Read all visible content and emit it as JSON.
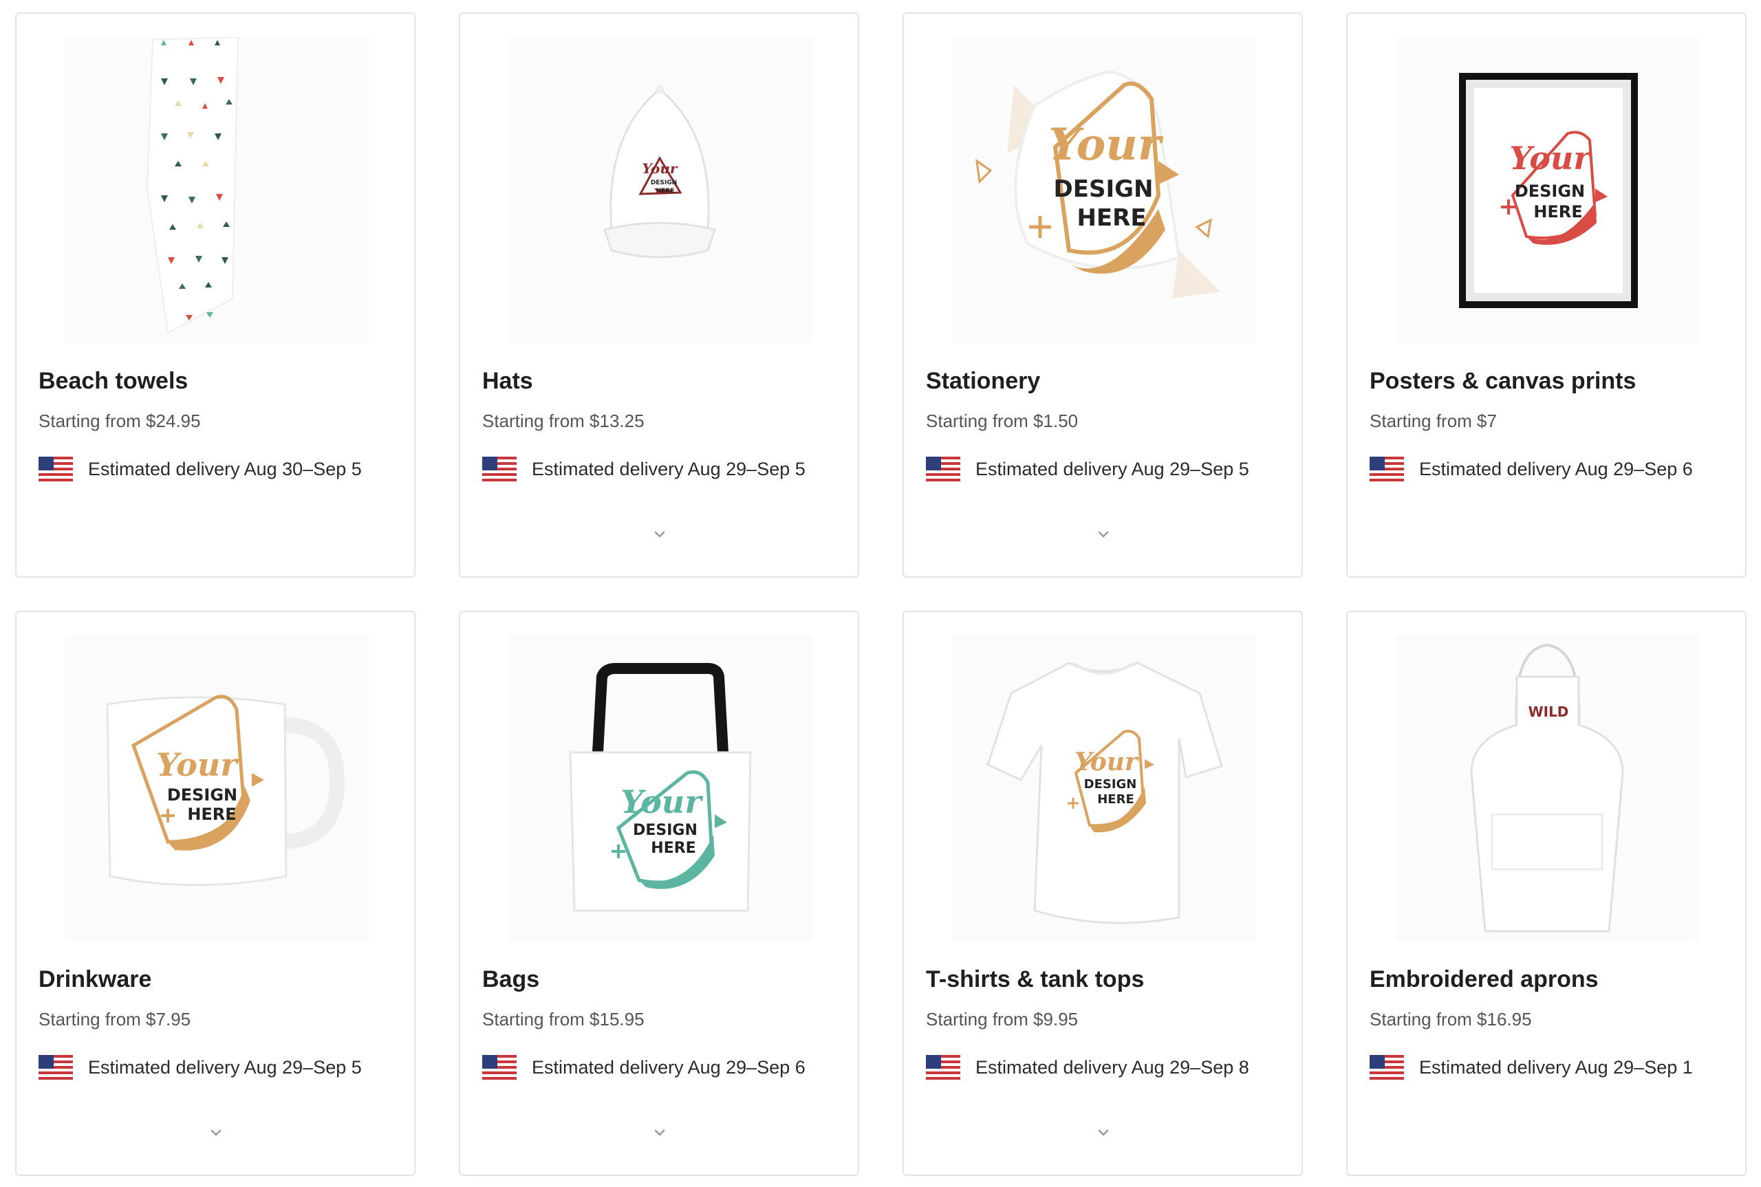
{
  "products": [
    {
      "title": "Beach towels",
      "price": "Starting from $24.95",
      "delivery": "Estimated delivery Aug 30–Sep 5",
      "image": "beach-towel",
      "expandable": false
    },
    {
      "title": "Hats",
      "price": "Starting from $13.25",
      "delivery": "Estimated delivery Aug 29–Sep 5",
      "image": "hat",
      "expandable": true
    },
    {
      "title": "Stationery",
      "price": "Starting from $1.50",
      "delivery": "Estimated delivery Aug 29–Sep 5",
      "image": "sticker",
      "expandable": true
    },
    {
      "title": "Posters & canvas prints",
      "price": "Starting from $7",
      "delivery": "Estimated delivery Aug 29–Sep 6",
      "image": "framed-poster",
      "expandable": false
    },
    {
      "title": "Drinkware",
      "price": "Starting from $7.95",
      "delivery": "Estimated delivery Aug 29–Sep 5",
      "image": "mug",
      "expandable": true
    },
    {
      "title": "Bags",
      "price": "Starting from $15.95",
      "delivery": "Estimated delivery Aug 29–Sep 6",
      "image": "tote-bag",
      "expandable": true
    },
    {
      "title": "T-shirts & tank tops",
      "price": "Starting from $9.95",
      "delivery": "Estimated delivery Aug 29–Sep 8",
      "image": "t-shirt",
      "expandable": true
    },
    {
      "title": "Embroidered aprons",
      "price": "Starting from $16.95",
      "delivery": "Estimated delivery Aug 29–Sep 1",
      "image": "apron",
      "expandable": false
    }
  ],
  "design_mark": {
    "line1": "Your",
    "line2": "DESIGN",
    "line3": "HERE"
  },
  "apron_text": "WILD",
  "icons": {
    "flag": "us-flag-icon",
    "expand": "chevron-down-icon"
  },
  "colors": {
    "title": "#1f1f1f",
    "price": "#555555",
    "border": "#e4e4e4",
    "gold": "#d9a35f",
    "red": "#d94b45",
    "teal": "#5bb5a0",
    "maroon": "#8a2a2a"
  }
}
